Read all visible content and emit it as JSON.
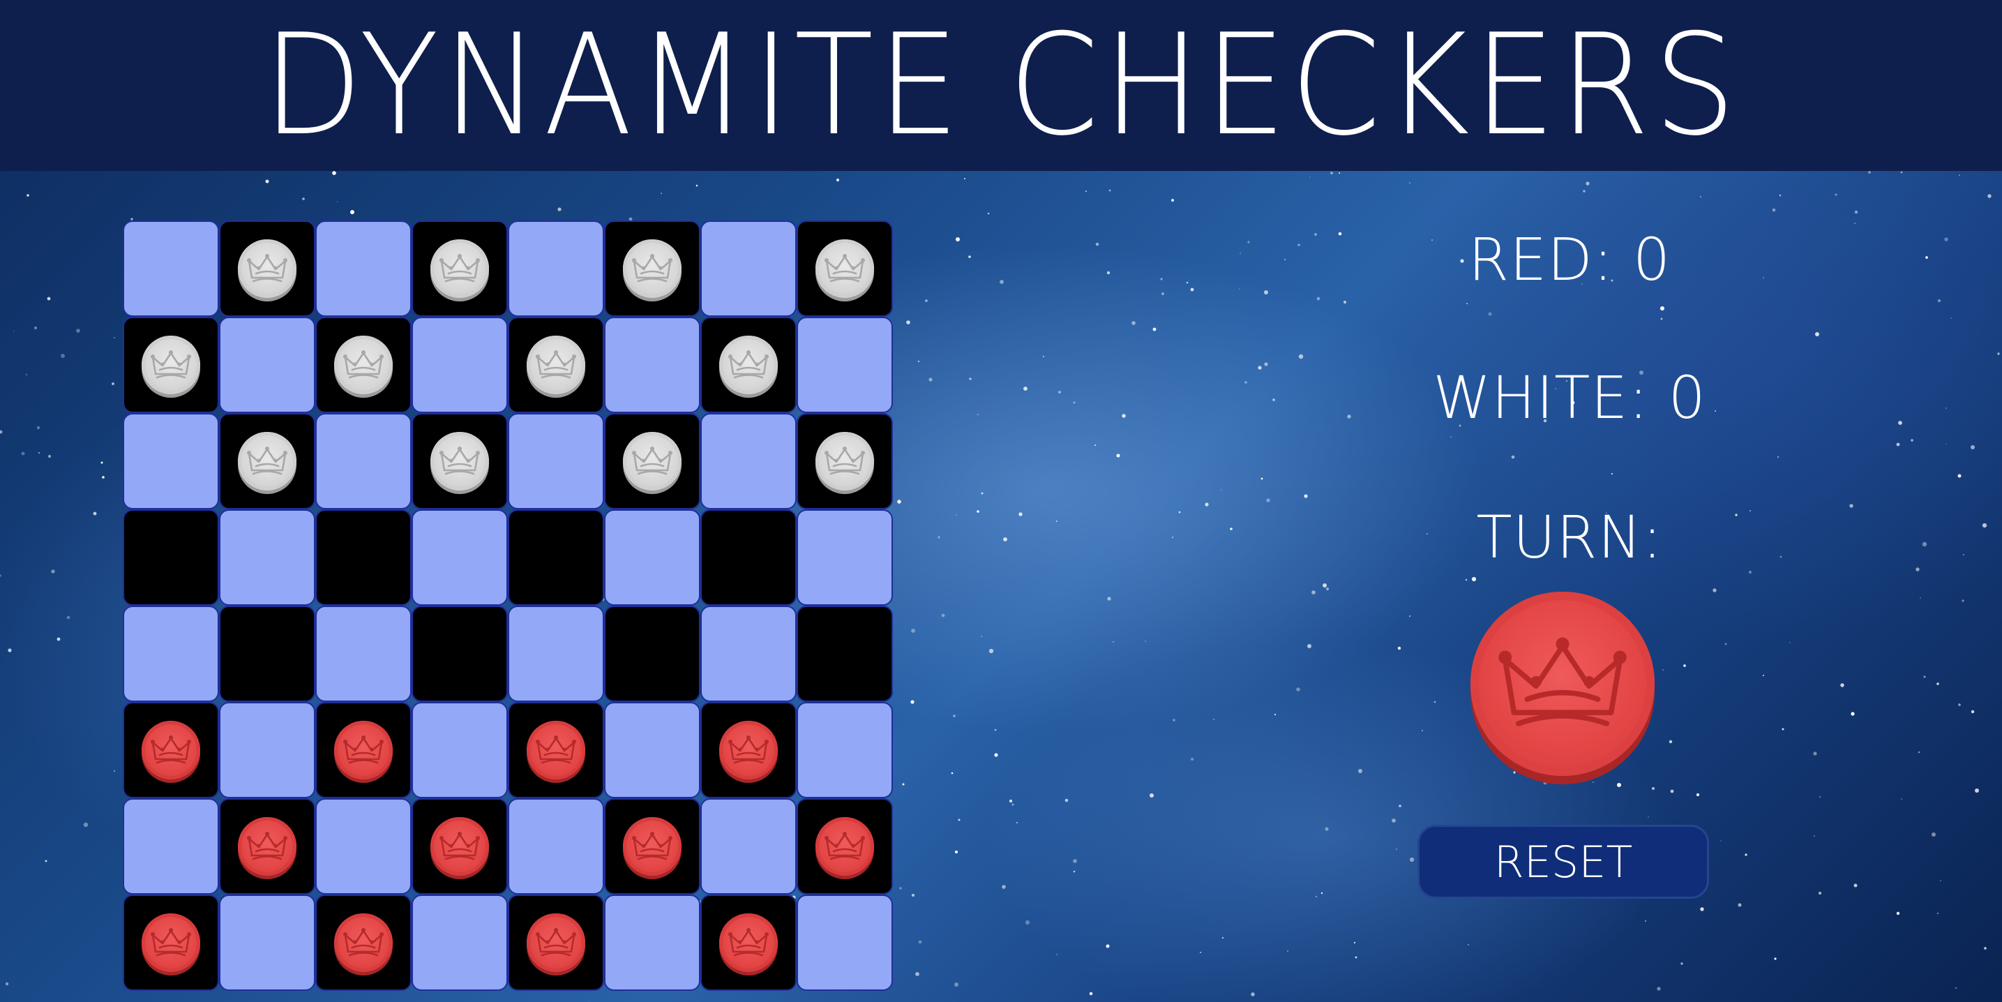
{
  "title": "DYNAMITE CHECKERS",
  "scoreboard": {
    "red": "RED: 0",
    "white": "WHITE: 0",
    "turn_label": "TURN:",
    "current_turn": "red"
  },
  "reset_label": "RESET",
  "colors": {
    "header_bg": "#0e1f4d",
    "light_square": "#93a9f7",
    "dark_square": "#000000",
    "square_border": "#1f2f9a",
    "red_piece": "#e34545",
    "white_piece": "#d6d6d6",
    "reset_button": "#0f2d78"
  },
  "board": {
    "rows": [
      [
        "-",
        "w",
        "-",
        "w",
        "-",
        "w",
        "-",
        "w"
      ],
      [
        "w",
        "-",
        "w",
        "-",
        "w",
        "-",
        "w",
        "-"
      ],
      [
        "-",
        "w",
        "-",
        "w",
        "-",
        "w",
        "-",
        "w"
      ],
      [
        "-",
        "-",
        "-",
        "-",
        "-",
        "-",
        "-",
        "-"
      ],
      [
        "-",
        "-",
        "-",
        "-",
        "-",
        "-",
        "-",
        "-"
      ],
      [
        "r",
        "-",
        "r",
        "-",
        "r",
        "-",
        "r",
        "-"
      ],
      [
        "-",
        "r",
        "-",
        "r",
        "-",
        "r",
        "-",
        "r"
      ],
      [
        "r",
        "-",
        "r",
        "-",
        "r",
        "-",
        "r",
        "-"
      ]
    ],
    "piece_icon": "crown-icon"
  }
}
